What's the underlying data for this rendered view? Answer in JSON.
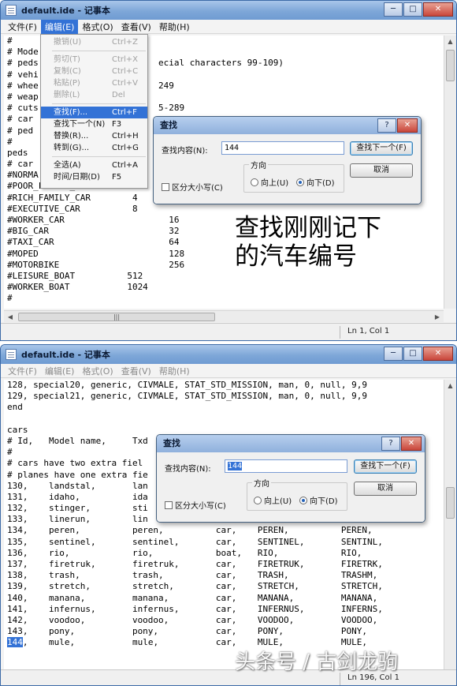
{
  "windows": [
    {
      "title": "default.ide - 记事本",
      "menu": [
        "文件(F)",
        "编辑(E)",
        "格式(O)",
        "查看(V)",
        "帮助(H)"
      ],
      "active_menu_index": 1,
      "lines": [
        "#",
        "# Mode",
        "# peds                       ecial characters 99-109)",
        "# vehi",
        "# whee                       249",
        "# weap",
        "# cuts                       5-289",
        "# car",
        "# ped",
        "#",
        "peds",
        "# car",
        "#NORMA",
        "#POOR_FAMILY_CAR        2",
        "#RICH_FAMILY_CAR        4",
        "#EXECUTIVE_CAR          8",
        "#WORKER_CAR                    16",
        "#BIG_CAR                       32",
        "#TAXI_CAR                      64",
        "#MOPED                         128",
        "#MOTORBIKE                     256",
        "#LEISURE_BOAT          512",
        "#WORKER_BOAT           1024",
        "#"
      ],
      "status": "Ln 1, Col 1",
      "dropdown": [
        {
          "label": "撤销(U)",
          "shortcut": "Ctrl+Z",
          "disabled": true
        },
        {
          "sep": true
        },
        {
          "label": "剪切(T)",
          "shortcut": "Ctrl+X",
          "disabled": true
        },
        {
          "label": "复制(C)",
          "shortcut": "Ctrl+C",
          "disabled": true
        },
        {
          "label": "粘贴(P)",
          "shortcut": "Ctrl+V",
          "disabled": true
        },
        {
          "label": "删除(L)",
          "shortcut": "Del",
          "disabled": true
        },
        {
          "sep": true
        },
        {
          "label": "查找(F)...",
          "shortcut": "Ctrl+F",
          "selected": true
        },
        {
          "label": "查找下一个(N)",
          "shortcut": "F3"
        },
        {
          "label": "替换(R)...",
          "shortcut": "Ctrl+H"
        },
        {
          "label": "转到(G)...",
          "shortcut": "Ctrl+G"
        },
        {
          "sep": true
        },
        {
          "label": "全选(A)",
          "shortcut": "Ctrl+A"
        },
        {
          "label": "时间/日期(D)",
          "shortcut": "F5"
        }
      ],
      "dialog": {
        "title": "查找",
        "find_label": "查找内容(N):",
        "find_value": "144",
        "find_next": "查找下一个(F)",
        "cancel": "取消",
        "direction_label": "方向",
        "up": "向上(U)",
        "down": "向下(D)",
        "match_case": "区分大小写(C)"
      },
      "annotation": "查找刚刚记下\n的汽车编号"
    },
    {
      "title": "default.ide - 记事本",
      "menu": [
        "文件(F)",
        "编辑(E)",
        "格式(O)",
        "查看(V)",
        "帮助(H)"
      ],
      "lines": [
        "128, special20, generic, CIVMALE, STAT_STD_MISSION, man, 0, null, 9,9",
        "129, special21, generic, CIVMALE, STAT_STD_MISSION, man, 0, null, 9,9",
        "end",
        "",
        "cars",
        "# Id,   Model name,     Txd",
        "#",
        "# cars have two extra fiel",
        "# planes have one extra fie",
        "130,    landstal,       lan",
        "131,    idaho,          ida",
        "132,    stinger,        sti",
        "133,    linerun,        lin",
        "134,    peren,          peren,          car,    PEREN,          PEREN,",
        "135,    sentinel,       sentinel,       car,    SENTINEL,       SENTINL,",
        "136,    rio,            rio,            boat,   RIO,            RIO,",
        "137,    firetruk,       firetruk,       car,    FIRETRUK,       FIRETRK,",
        "138,    trash,          trash,          car,    TRASH,          TRASHM,",
        "139,    stretch,        stretch,        car,    STRETCH,        STRETCH,",
        "140,    manana,         manana,         car,    MANANA,         MANANA,",
        "141,    infernus,       infernus,       car,    INFERNUS,       INFERNS,",
        "142,    voodoo,         voodoo,         car,    VOODOO,         VOODOO,",
        "143,    pony,           pony,           car,    PONY,           PONY,",
        "144,    mule,           mule,           car,    MULE,           MULE,"
      ],
      "highlight_line": 23,
      "highlight_text": "144",
      "status": "Ln 196, Col 1",
      "dialog": {
        "title": "查找",
        "find_label": "查找内容(N):",
        "find_value": "144",
        "find_next": "查找下一个(F)",
        "cancel": "取消",
        "direction_label": "方向",
        "up": "向上(U)",
        "down": "向下(D)",
        "match_case": "区分大小写(C)"
      }
    }
  ],
  "window_controls": {
    "minimize": "─",
    "maximize": "□",
    "close": "✕",
    "help": "?"
  },
  "watermark": "头条号 / 古剑龙驹"
}
